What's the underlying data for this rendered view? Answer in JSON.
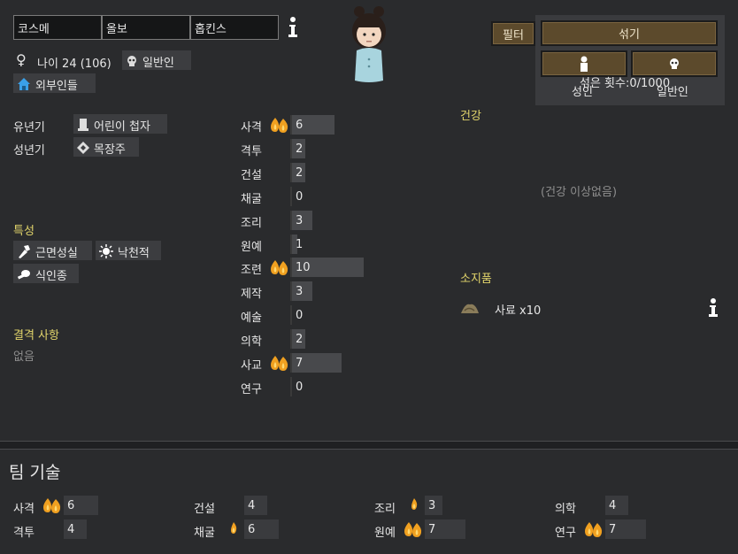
{
  "name": {
    "first": "코스메",
    "nick": "올보",
    "last": "홉킨스"
  },
  "info_icon": "info-icon",
  "bio": {
    "gender_symbol": "♀",
    "age_text": "나이 24 (106)",
    "title": "일반인",
    "faction": "외부인들"
  },
  "backstory": {
    "childhood_label": "유년기",
    "childhood_value": "어린이 첩자",
    "adulthood_label": "성년기",
    "adulthood_value": "목장주"
  },
  "traits": {
    "header": "특성",
    "items": [
      "근면성실",
      "낙천적",
      "식인종"
    ]
  },
  "incapable": {
    "header": "결격 사항",
    "value": "없음"
  },
  "skills": [
    {
      "label": "사격",
      "value": "6",
      "passion": "major"
    },
    {
      "label": "격투",
      "value": "2",
      "passion": "none"
    },
    {
      "label": "건설",
      "value": "2",
      "passion": "none"
    },
    {
      "label": "채굴",
      "value": "0",
      "passion": "none"
    },
    {
      "label": "조리",
      "value": "3",
      "passion": "none"
    },
    {
      "label": "원예",
      "value": "1",
      "passion": "none"
    },
    {
      "label": "조련",
      "value": "10",
      "passion": "major"
    },
    {
      "label": "제작",
      "value": "3",
      "passion": "none"
    },
    {
      "label": "예술",
      "value": "0",
      "passion": "none"
    },
    {
      "label": "의학",
      "value": "2",
      "passion": "none"
    },
    {
      "label": "사교",
      "value": "7",
      "passion": "major"
    },
    {
      "label": "연구",
      "value": "0",
      "passion": "none"
    }
  ],
  "health": {
    "header": "건강",
    "status": "(건강 이상없음)"
  },
  "inventory": {
    "header": "소지품",
    "item": "사료 x10"
  },
  "controls": {
    "filter": "필터",
    "randomize": "섞기",
    "adult_label": "성인",
    "normal_label": "일반인",
    "shuffle_count": "섞은 횟수:0/1000"
  },
  "team": {
    "title": "팀 기술",
    "entries": [
      {
        "label": "사격",
        "value": "6",
        "passion": "major"
      },
      {
        "label": "격투",
        "value": "4",
        "passion": "none"
      },
      {
        "label": "건설",
        "value": "4",
        "passion": "none"
      },
      {
        "label": "채굴",
        "value": "6",
        "passion": "minor"
      },
      {
        "label": "조리",
        "value": "3",
        "passion": "minor"
      },
      {
        "label": "원예",
        "value": "7",
        "passion": "major"
      },
      {
        "label": "의학",
        "value": "4",
        "passion": "none"
      },
      {
        "label": "연구",
        "value": "7",
        "passion": "major"
      }
    ]
  },
  "colors": {
    "panel": "#2a2b2d",
    "accent_yellow": "#e2d56b",
    "button_brown": "#5c4a2c",
    "flame": "#f0a020"
  }
}
